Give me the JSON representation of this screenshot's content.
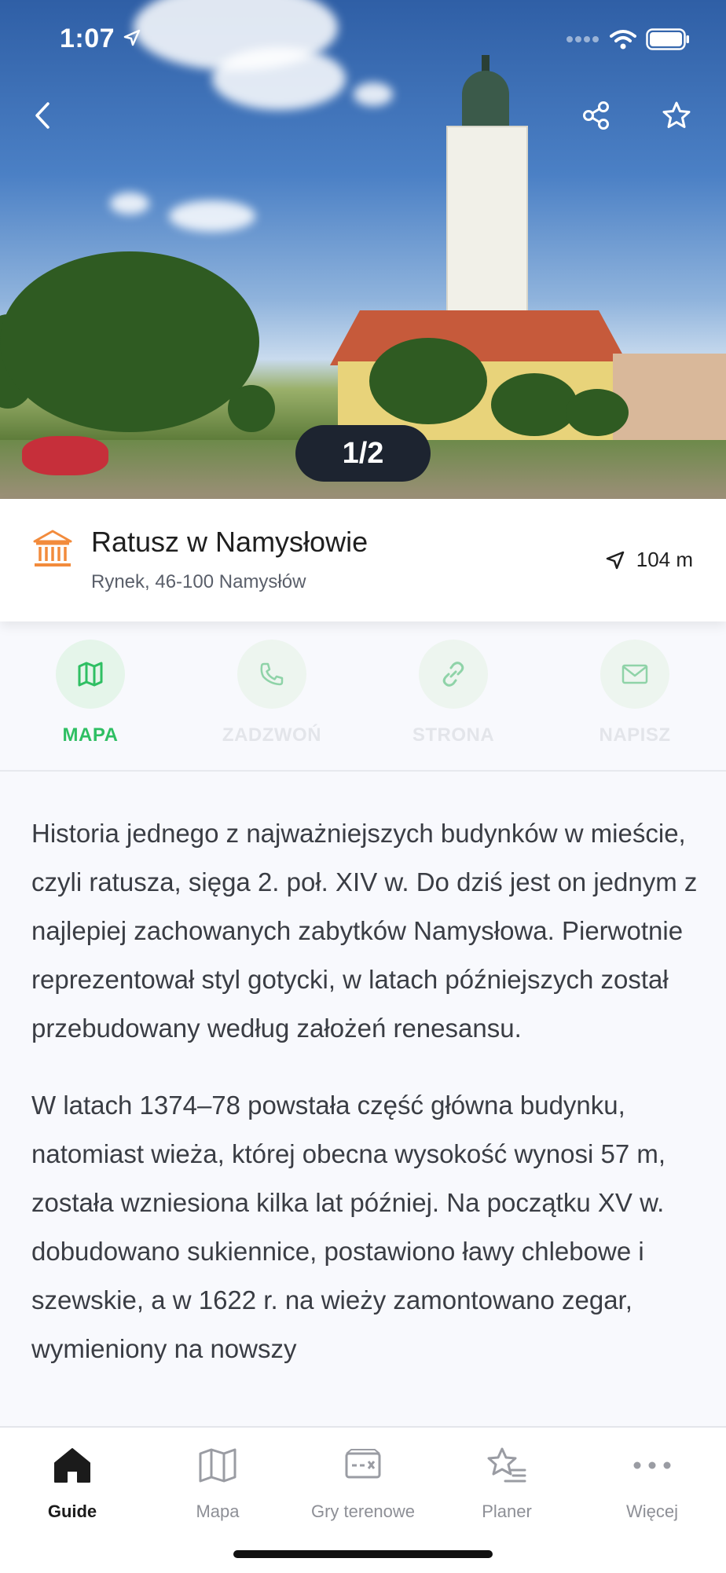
{
  "status_bar": {
    "time": "1:07"
  },
  "hero": {
    "counter": "1/2"
  },
  "poi": {
    "title": "Ratusz w Namysłowie",
    "address": "Rynek, 46-100 Namysłów",
    "distance": "104 m",
    "icon": "museum-icon",
    "accent_color": "#f28b3c"
  },
  "actions": [
    {
      "label": "MAPA",
      "icon": "map-icon",
      "state": "active"
    },
    {
      "label": "ZADZWOŃ",
      "icon": "phone-icon",
      "state": "disabled"
    },
    {
      "label": "STRONA",
      "icon": "link-icon",
      "state": "disabled"
    },
    {
      "label": "NAPISZ",
      "icon": "mail-icon",
      "state": "disabled"
    }
  ],
  "description": [
    "Historia jednego z najważniejszych budynków w mieście, czyli ratusza, sięga 2. poł. XIV w. Do dziś jest on jednym z najlepiej zachowanych zabytków Namysłowa. Pierwotnie reprezentował styl gotycki, w latach późniejszych został przebudowany według założeń renesansu.",
    "W latach 1374–78 powstała część główna budynku, natomiast wieża, której obecna wysokość wynosi 57 m, została wzniesiona kilka lat później. Na początku XV w. dobudowano sukiennice, postawiono ławy chlebowe i szewskie, a w 1622 r. na wieży zamontowano zegar, wymieniony na nowszy"
  ],
  "tabs": [
    {
      "label": "Guide",
      "icon": "home-icon",
      "active": true
    },
    {
      "label": "Mapa",
      "icon": "map-icon",
      "active": false
    },
    {
      "label": "Gry terenowe",
      "icon": "ticket-icon",
      "active": false
    },
    {
      "label": "Planer",
      "icon": "star-list-icon",
      "active": false
    },
    {
      "label": "Więcej",
      "icon": "more-icon",
      "active": false
    }
  ],
  "colors": {
    "accent_green": "#2fbf63",
    "counter_bg": "#1d2430"
  }
}
